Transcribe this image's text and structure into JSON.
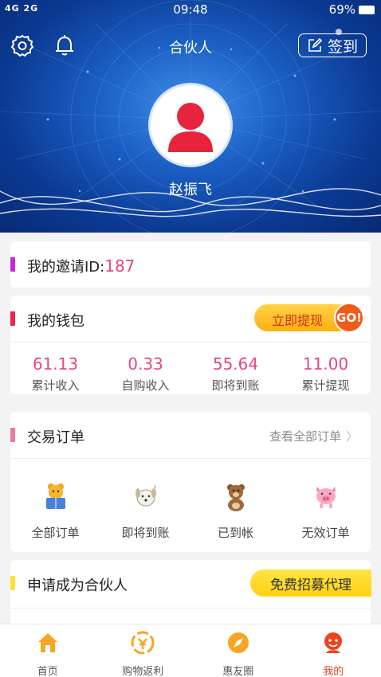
{
  "status_bar": {
    "signal": "4G 2G",
    "time": "09:48",
    "battery": "69%"
  },
  "header": {
    "title": "合伙人",
    "checkin_label": "签到",
    "username": "赵振飞"
  },
  "invite": {
    "label": "我的邀请ID:",
    "value": "187"
  },
  "wallet": {
    "title": "我的钱包",
    "withdraw_label": "立即提现",
    "go_label": "GO!",
    "stats": [
      {
        "value": "61.13",
        "label": "累计收入"
      },
      {
        "value": "0.33",
        "label": "自购收入"
      },
      {
        "value": "55.64",
        "label": "即将到账"
      },
      {
        "value": "11.00",
        "label": "累计提现"
      }
    ]
  },
  "orders": {
    "title": "交易订单",
    "view_all": "查看全部订单",
    "items": [
      {
        "label": "全部订单",
        "icon": "bear-reading-icon"
      },
      {
        "label": "即将到账",
        "icon": "dog-icon"
      },
      {
        "label": "已到帐",
        "icon": "bear-icon"
      },
      {
        "label": "无效订单",
        "icon": "pig-icon"
      }
    ]
  },
  "partner": {
    "title": "申请成为合伙人",
    "recruit_label": "免费招募代理"
  },
  "tabbar": {
    "tabs": [
      {
        "label": "首页",
        "icon": "home-icon"
      },
      {
        "label": "购物返利",
        "icon": "rebate-icon"
      },
      {
        "label": "惠友圈",
        "icon": "compass-icon"
      },
      {
        "label": "我的",
        "icon": "profile-icon",
        "active": true
      }
    ]
  },
  "colors": {
    "accent": "#e8467e",
    "active_tab": "#f2421c",
    "header_blue": "#1b5fc4"
  }
}
